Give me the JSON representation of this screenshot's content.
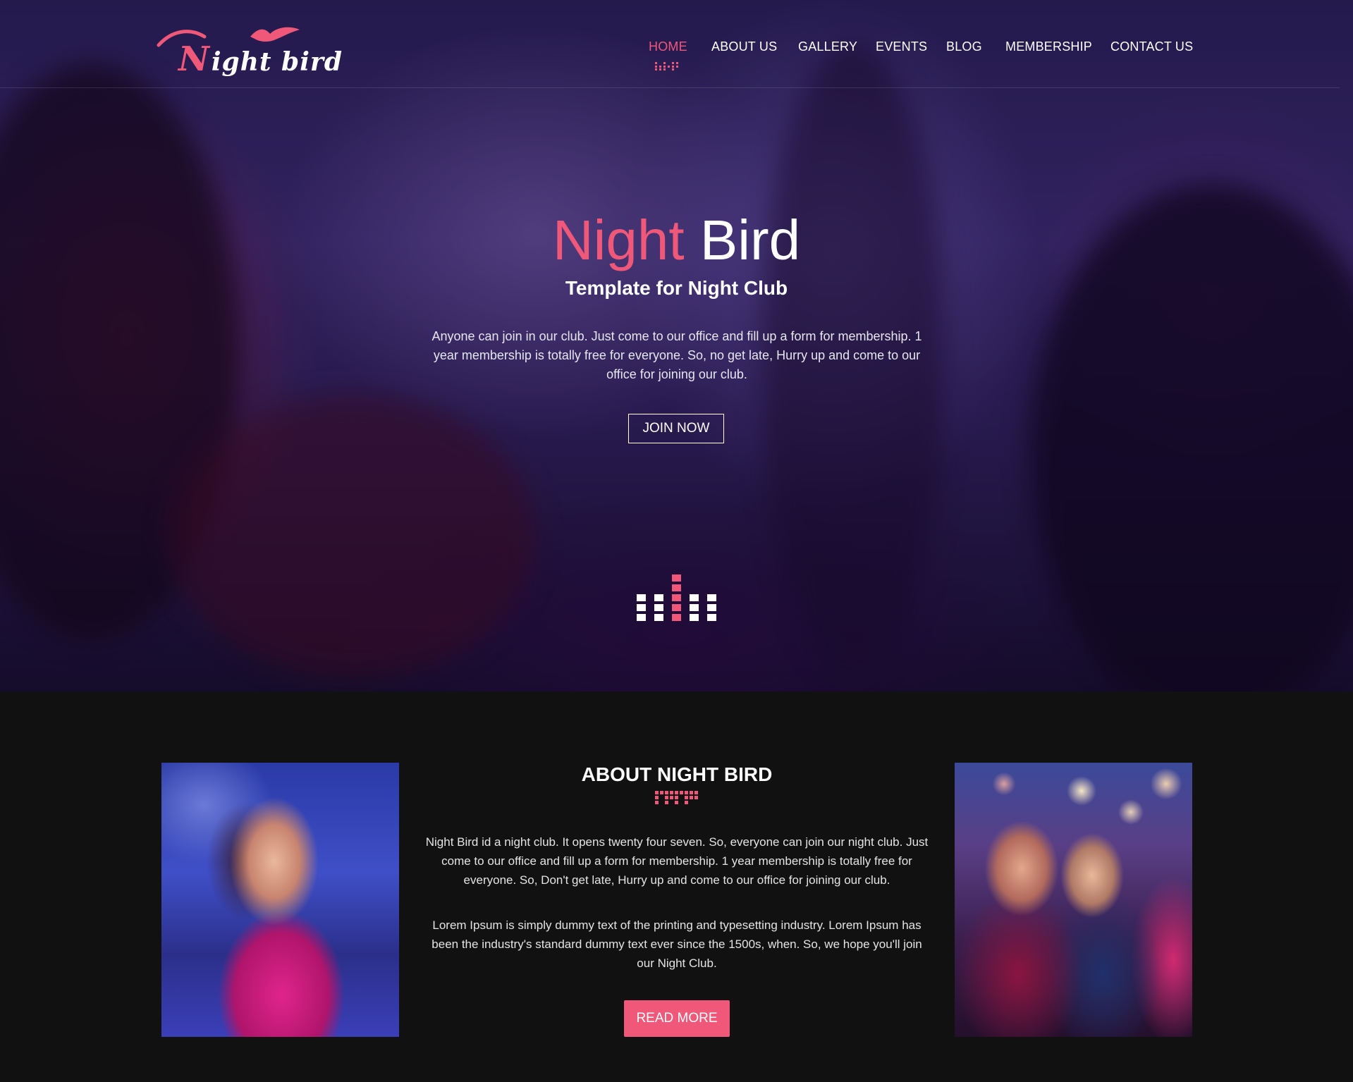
{
  "brand": {
    "logo_initial": "N",
    "logo_rest": "ight bird",
    "colors": {
      "accent": "#f0587a",
      "background": "#111111",
      "text": "#ffffff"
    }
  },
  "nav": {
    "items": [
      {
        "label": "HOME",
        "active": true
      },
      {
        "label": "ABOUT US",
        "active": false
      },
      {
        "label": "GALLERY",
        "active": false
      },
      {
        "label": "EVENTS",
        "active": false
      },
      {
        "label": "BLOG",
        "active": false
      },
      {
        "label": "MEMBERSHIP",
        "active": false
      },
      {
        "label": "CONTACT US",
        "active": false
      }
    ]
  },
  "hero": {
    "title_pink": "Night",
    "title_white": "Bird",
    "subtitle": "Template for Night Club",
    "description": "Anyone can join in our club. Just come to our office and fill up a form for membership. 1 year membership is totally free for everyone. So, no get late, Hurry up and come to our office for joining our club.",
    "button": "JOIN NOW",
    "scroll_icon": "equalizer-icon"
  },
  "about": {
    "title": "ABOUT NIGHT BIRD",
    "paragraph1": "Night Bird id a night club. It opens twenty four seven. So, everyone can join our night club. Just come to our office and fill up a form for membership. 1 year membership is totally free for everyone. So, Don't get late, Hurry up and come to our office for joining our club.",
    "paragraph2": "Lorem Ipsum is simply dummy text of the printing and typesetting industry. Lorem Ipsum has been the industry's standard dummy text ever since the 1500s, when. So, we hope you'll join our Night Club.",
    "button": "READ MORE"
  }
}
